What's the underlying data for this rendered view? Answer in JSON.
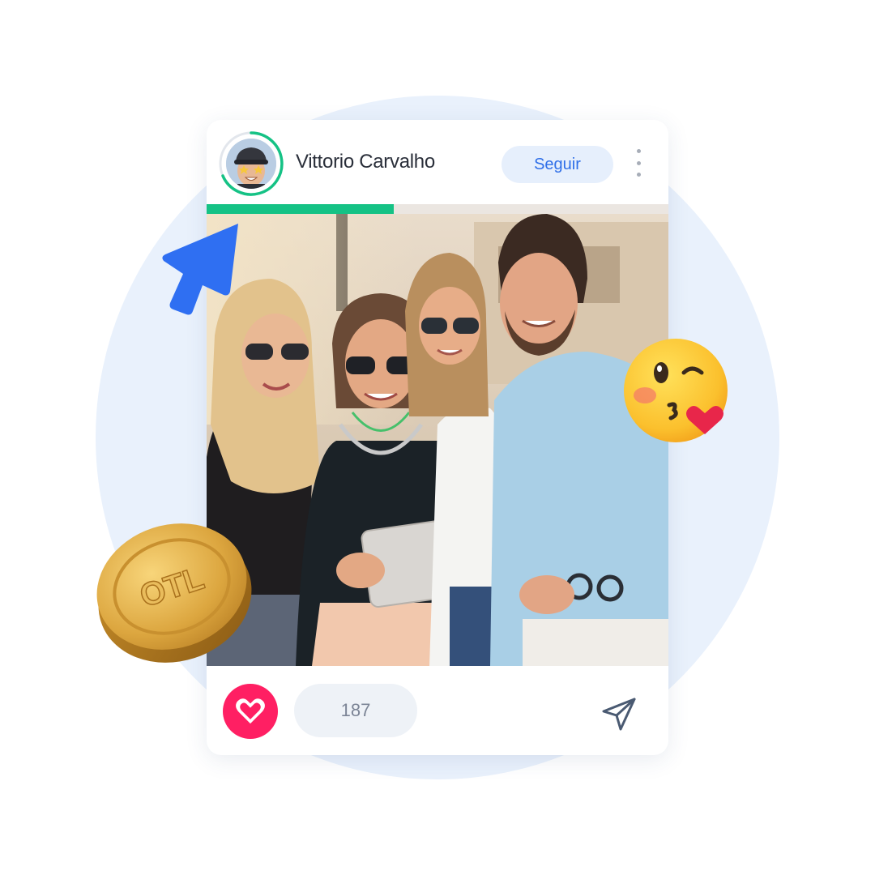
{
  "post": {
    "author": "Vittorio Carvalho",
    "follow_label": "Seguir",
    "story_progress": 0.405,
    "like_count": "187"
  },
  "coin": {
    "label": "OTL"
  },
  "icons": {
    "more": "more-vertical-icon",
    "like": "heart-icon",
    "share": "send-icon",
    "cursor": "pointer-arrow-icon",
    "emoji": "kissing-face-emoji",
    "coin": "gold-coin-icon"
  },
  "colors": {
    "accent_blue": "#2f6fe8",
    "like_pink": "#ff1f63",
    "progress_green": "#15c285",
    "background_circle": "#e9f1fc"
  }
}
